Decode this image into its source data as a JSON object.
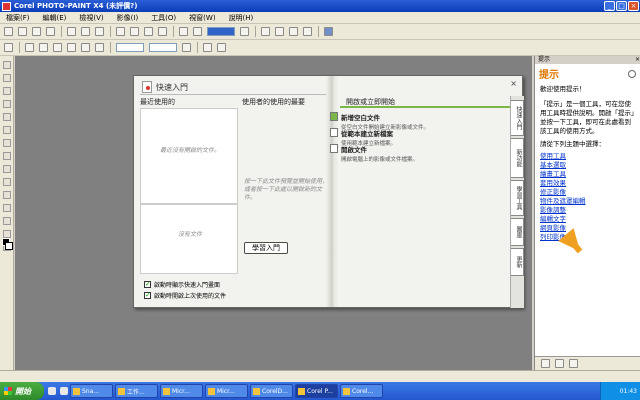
{
  "window": {
    "title": "Corel PHOTO-PAINT X4 (未評價?)"
  },
  "menu": [
    "檔案(F)",
    "編輯(E)",
    "檢視(V)",
    "影像(I)",
    "工具(O)",
    "視窗(W)",
    "說明(H)"
  ],
  "welcome": {
    "title": "快速入門",
    "close": "×",
    "col1_head": "最近使用的",
    "col2_head": "使用者的使用的最要",
    "col3_head": "開啟或立即開始",
    "left_muted_top": "最近沒有開啟的文件。",
    "left_muted_bottom": "沒有文件",
    "center_muted": "按一下此文件預覽並開始使用，或者按一下此處以開啟新的文件。",
    "learn_button": "學習入門",
    "checkbox1": "啟動時顯示快速入門畫面",
    "checkbox2": "啟動時開啟上次使用的文件",
    "actions": [
      {
        "title": "新增空白文件",
        "desc": "從空白文件開始建立新影像或文件。"
      },
      {
        "title": "從範本建立新檔案",
        "desc": "使用範本建立新檔案。"
      },
      {
        "title": "開啟文件",
        "desc": "開啟電腦上的影像或文件檔案。"
      }
    ],
    "tabs": [
      "快速入門",
      "新功能",
      "學習工具",
      "圖庫",
      "更新"
    ]
  },
  "hints": {
    "bar_title": "提示",
    "title": "提示",
    "intro": "歡迎使用提示！",
    "body": "「提示」是一個工具，可在您使用工具時提供說明。開啟「提示」並按一下工具，即可在此處看到該工具的使用方式。",
    "subhead": "請從下列主題中選擇：",
    "links": [
      "使用工具",
      "基本選取",
      "繪畫工具",
      "套用效果",
      "修正影像",
      "物件及遮罩編輯",
      "影像調整",
      "編輯文字",
      "網頁影像",
      "列印影像"
    ]
  },
  "taskbar": {
    "start": "開始",
    "items": [
      "Sna...",
      "工作...",
      "Micr...",
      "Micr...",
      "CorelD...",
      "Corel P...",
      "Corel..."
    ],
    "clock": "01:43"
  }
}
